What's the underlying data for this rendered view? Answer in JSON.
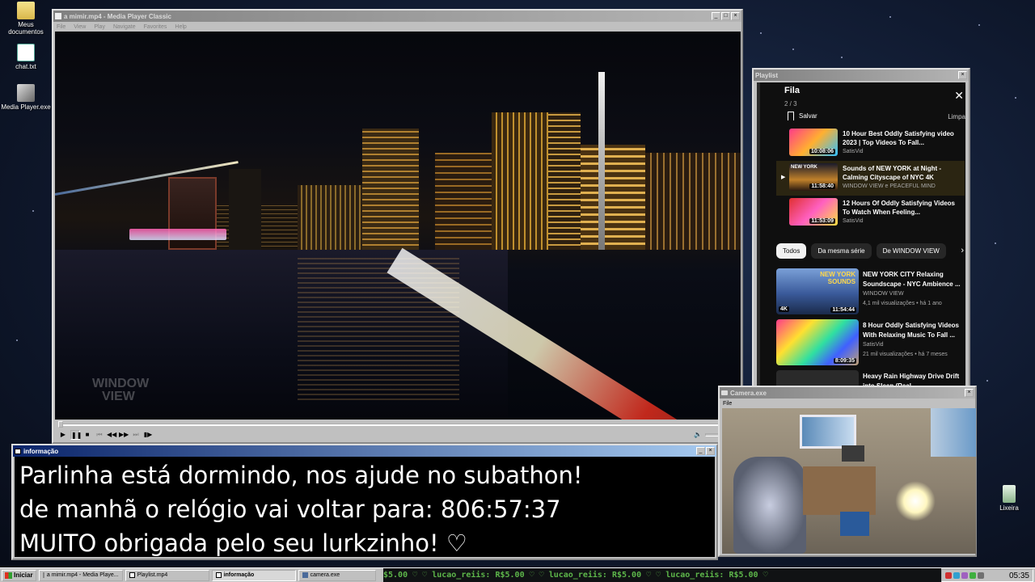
{
  "desktop": {
    "icons": [
      {
        "label": "Meus documentos",
        "icon": "folder-icon"
      },
      {
        "label": "chat.txt",
        "icon": "notepad-icon"
      },
      {
        "label": "Media Player.exe",
        "icon": "media-player-icon"
      },
      {
        "label": "Lixeira",
        "icon": "recycle-bin-icon"
      }
    ]
  },
  "mpc": {
    "title": "a mimir.mp4 - Media Player Classic",
    "menu": [
      "File",
      "View",
      "Play",
      "Navigate",
      "Favorites",
      "Help"
    ],
    "watermark": [
      "WINDOW",
      "VIEW"
    ],
    "seek_progress": 0.0
  },
  "playlist": {
    "title": "Playlist",
    "fila_title": "Fila",
    "count": "2 / 3",
    "save_label": "Salvar",
    "clear_label": "Limpa",
    "queue": [
      {
        "title": "10 Hour Best Oddly Satisfying video 2023 | Top Videos To Fall...",
        "channel": "SatisVid",
        "duration": "10:08:06",
        "active": false
      },
      {
        "title": "Sounds of NEW YORK at Night - Calming Cityscape of NYC 4K",
        "channel": "WINDOW VIEW e PEACEFUL MIND",
        "duration": "11:58:40",
        "active": true
      },
      {
        "title": "12 Hours Of Oddly Satisfying Videos To Watch When Feeling...",
        "channel": "SatisVid",
        "duration": "11:53:09",
        "active": false
      }
    ],
    "chips": [
      "Todos",
      "Da mesma série",
      "De WINDOW VIEW"
    ],
    "recommended": [
      {
        "title": "NEW YORK CITY Relaxing Soundscape - NYC Ambience ...",
        "channel": "WINDOW VIEW",
        "meta": "4,1 mil visualizações • há 1 ano",
        "duration": "11:54:44",
        "badge": "4K",
        "thumb_text": "NEW YORK SOUNDS"
      },
      {
        "title": "8 Hour Oddly Satisfying Videos With Relaxing Music To Fall ...",
        "channel": "SatisVid",
        "meta": "21 mil visualizações • há 7 meses",
        "duration": "8:09:35",
        "badge": "",
        "thumb_text": ""
      },
      {
        "title": "Heavy Rain Highway Drive Drift into Sleep (Real...",
        "channel": "",
        "meta": "",
        "duration": "",
        "badge": "",
        "thumb_text": ""
      }
    ]
  },
  "info": {
    "title": "informação",
    "lines": [
      "Parlinha está dormindo, nos ajude no subathon!",
      "de manhã o relógio vai voltar para:  806:57:37",
      "MUITO obrigada pelo seu lurkzinho! ♡"
    ]
  },
  "camera": {
    "title": "Camera.exe",
    "menu": [
      "File"
    ]
  },
  "taskbar": {
    "start_label": "Iniciar",
    "tasks": [
      {
        "label": "a mimir.mp4 - Media Playe...",
        "icon": "media-player-icon",
        "active": false
      },
      {
        "label": "Playlist.mp4",
        "icon": "window-icon",
        "active": false
      },
      {
        "label": "informação",
        "icon": "window-icon",
        "active": true
      },
      {
        "label": "camera.exe",
        "icon": "camera-icon",
        "active": false
      }
    ],
    "ticker": "$5.00 ♡  ♡ lucao_reiis: R$5.00 ♡  ♡ lucao_reiis: R$5.00 ♡  ♡ lucao_reiis: R$5.00 ♡",
    "clock": "05:35"
  },
  "colors": {
    "titlebar_active": "#0a246a",
    "titlebar_inactive": "#808080",
    "ticker_green": "#5db64a",
    "youtube_bg": "#0f0f0f"
  }
}
